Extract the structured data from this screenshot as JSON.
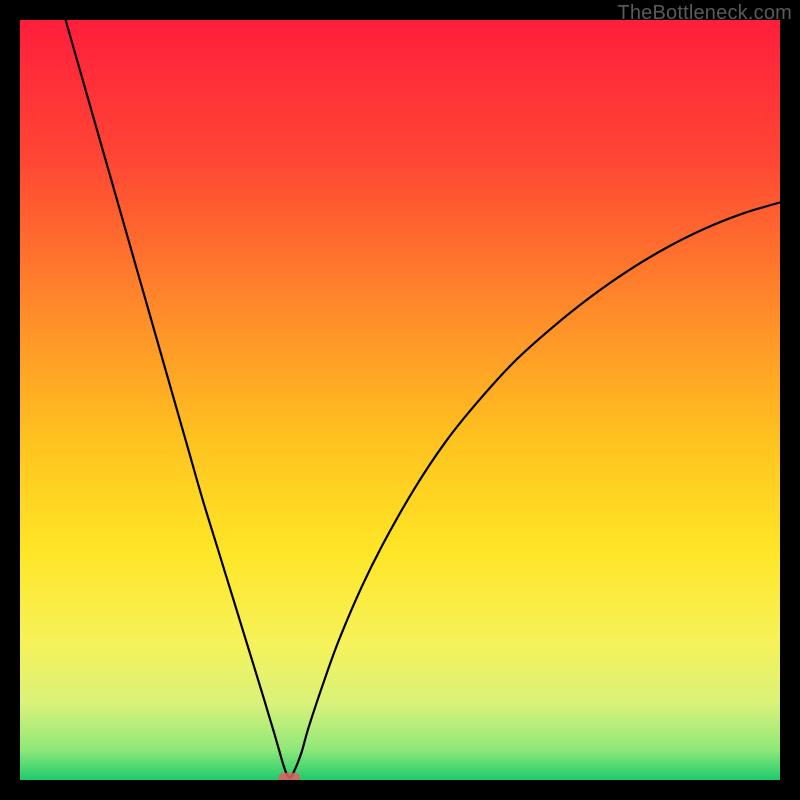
{
  "watermark": "TheBottleneck.com",
  "colors": {
    "frame": "#000000",
    "curve": "#000000",
    "marker": "#e06060",
    "gradient_stops": [
      {
        "offset": 0.0,
        "color": "#ff1e3c"
      },
      {
        "offset": 0.18,
        "color": "#ff4534"
      },
      {
        "offset": 0.38,
        "color": "#ff8a2a"
      },
      {
        "offset": 0.55,
        "color": "#ffc21f"
      },
      {
        "offset": 0.7,
        "color": "#ffe627"
      },
      {
        "offset": 0.82,
        "color": "#f6f25a"
      },
      {
        "offset": 0.9,
        "color": "#d9f27a"
      },
      {
        "offset": 0.96,
        "color": "#8fe87a"
      },
      {
        "offset": 1.0,
        "color": "#1ecb6b"
      }
    ]
  },
  "chart_data": {
    "type": "line",
    "title": "",
    "xlabel": "",
    "ylabel": "",
    "xlim": [
      0,
      100
    ],
    "ylim": [
      0,
      100
    ],
    "series": [
      {
        "name": "bottleneck-curve",
        "x": [
          6,
          8,
          10,
          12,
          14,
          16,
          18,
          20,
          22,
          24,
          26,
          28,
          30,
          32,
          33.5,
          34.5,
          35,
          35.5,
          36,
          37,
          38,
          40,
          42,
          45,
          48,
          52,
          56,
          60,
          65,
          70,
          75,
          80,
          85,
          90,
          95,
          100
        ],
        "values": [
          100,
          93,
          86,
          79,
          72,
          65,
          58,
          51,
          44,
          37,
          30.5,
          24,
          17.5,
          11,
          6,
          2.5,
          1,
          0.3,
          1,
          3.5,
          7,
          13,
          18.5,
          25.5,
          31.5,
          38.5,
          44.5,
          49.5,
          55,
          59.5,
          63.5,
          67,
          70,
          72.5,
          74.5,
          76
        ]
      }
    ],
    "annotations": [
      {
        "name": "min-marker",
        "x": 35.3,
        "y": 0.3
      }
    ]
  }
}
